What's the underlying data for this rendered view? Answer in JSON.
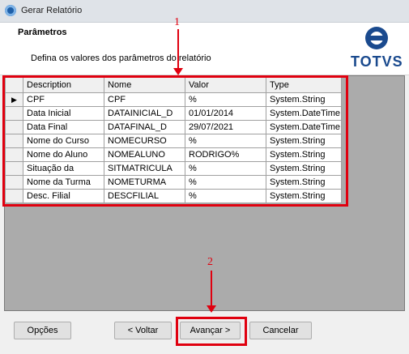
{
  "window": {
    "title": "Gerar Relatório"
  },
  "header": {
    "title": "Parâmetros",
    "subtitle": "Defina os valores dos parâmetros do relatório",
    "logo_text": "TOTVS"
  },
  "grid": {
    "columns": [
      "Description",
      "Nome",
      "Valor",
      "Type"
    ],
    "current_row_marker": "▶",
    "rows": [
      [
        "CPF",
        "CPF",
        "%",
        "System.String"
      ],
      [
        "Data Inicial",
        "DATAINICIAL_D",
        "01/01/2014",
        "System.DateTime"
      ],
      [
        "Data Final",
        "DATAFINAL_D",
        "29/07/2021",
        "System.DateTime"
      ],
      [
        "Nome do Curso",
        "NOMECURSO",
        "%",
        "System.String"
      ],
      [
        "Nome do Aluno",
        "NOMEALUNO",
        "RODRIGO%",
        "System.String"
      ],
      [
        "Situação da",
        "SITMATRICULA",
        "%",
        "System.String"
      ],
      [
        "Nome da Turma",
        "NOMETURMA",
        "%",
        "System.String"
      ],
      [
        "Desc. Filial",
        "DESCFILIAL",
        "%",
        "System.String"
      ]
    ]
  },
  "annotations": {
    "first": "1",
    "second": "2"
  },
  "buttons": {
    "options": "Opções",
    "back": "< Voltar",
    "next": "Avançar >",
    "cancel": "Cancelar"
  },
  "colors": {
    "annotation": "#e0000f",
    "brand": "#1a4a8e"
  }
}
